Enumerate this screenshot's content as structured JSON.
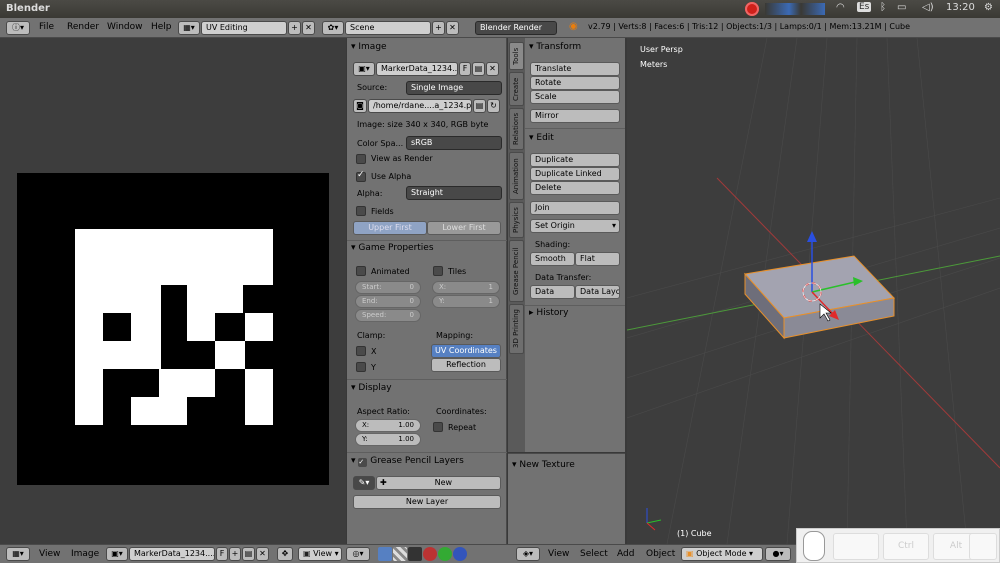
{
  "os": {
    "app_title": "Blender",
    "lang": "Es",
    "time": "13:20"
  },
  "info_header": {
    "menus": [
      "File",
      "Render",
      "Window",
      "Help"
    ],
    "layout": "UV Editing",
    "scene": "Scene",
    "engine": "Blender Render",
    "stats": "v2.79 | Verts:8 | Faces:6 | Tris:12 | Objects:1/3 | Lamps:0/1 | Mem:13.21M | Cube"
  },
  "image_panel": {
    "title": "Image",
    "image_name": "MarkerData_1234....",
    "fake_user": "F",
    "source_label": "Source:",
    "source_value": "Single Image",
    "filepath": "/home/rdane....a_1234.png",
    "info": "Image: size 340 x 340, RGB byte",
    "colorspace_label": "Color Spa...",
    "colorspace_value": "sRGB",
    "view_as_render": "View as Render",
    "use_alpha": "Use Alpha",
    "alpha_label": "Alpha:",
    "alpha_value": "Straight",
    "fields": "Fields",
    "upper_first": "Upper First",
    "lower_first": "Lower First"
  },
  "game_panel": {
    "title": "Game Properties",
    "animated": "Animated",
    "tiles": "Tiles",
    "start": "Start:",
    "start_val": "0",
    "end": "End:",
    "end_val": "0",
    "speed": "Speed:",
    "speed_val": "0",
    "tx": "X:",
    "tx_val": "1",
    "ty": "Y:",
    "ty_val": "1",
    "clamp": "Clamp:",
    "mapping": "Mapping:",
    "cx": "X",
    "cy": "Y",
    "uv_coords": "UV Coordinates",
    "reflection": "Reflection"
  },
  "display_panel": {
    "title": "Display",
    "aspect": "Aspect Ratio:",
    "coords": "Coordinates:",
    "ax": "X:",
    "ax_val": "1.00",
    "ay": "Y:",
    "ay_val": "1.00",
    "repeat": "Repeat"
  },
  "gp_panel": {
    "title": "Grease Pencil Layers",
    "new": "New",
    "new_layer": "New Layer"
  },
  "tabs": [
    "Tools",
    "Create",
    "Relations",
    "Animation",
    "Physics",
    "Grease Pencil",
    "3D Printing"
  ],
  "tools": {
    "transform": "Transform",
    "translate": "Translate",
    "rotate": "Rotate",
    "scale": "Scale",
    "mirror": "Mirror",
    "edit": "Edit",
    "duplicate": "Duplicate",
    "duplicate_linked": "Duplicate Linked",
    "delete": "Delete",
    "join": "Join",
    "set_origin": "Set Origin",
    "shading": "Shading:",
    "smooth": "Smooth",
    "flat": "Flat",
    "data_transfer": "Data Transfer:",
    "data": "Data",
    "data_layo": "Data Layo",
    "history": "History",
    "new_texture": "New Texture"
  },
  "view3d": {
    "persp": "User Persp",
    "units": "Meters",
    "object": "(1) Cube"
  },
  "uv_header": {
    "view": "View",
    "image": "Image",
    "image_name": "MarkerData_1234....",
    "fake": "F",
    "view2": "View"
  },
  "v3d_header": {
    "view": "View",
    "select": "Select",
    "add": "Add",
    "object": "Object",
    "mode": "Object Mode"
  },
  "keys": {
    "ctrl": "Ctrl",
    "alt": "Alt"
  }
}
